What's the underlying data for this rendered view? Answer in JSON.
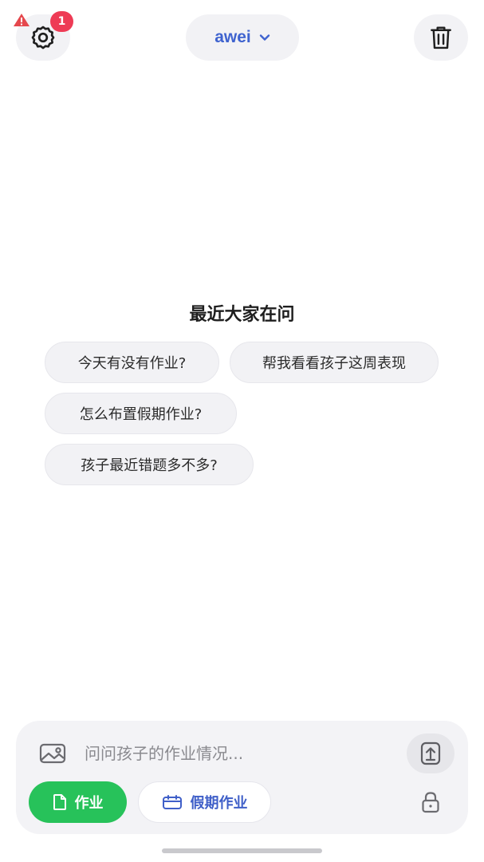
{
  "header": {
    "notification_count": "1",
    "user_name": "awei"
  },
  "main": {
    "section_title": "最近大家在问",
    "suggestions": [
      "今天有没有作业?",
      "帮我看看孩子这周表现",
      "怎么布置假期作业?",
      "孩子最近错题多不多?"
    ]
  },
  "composer": {
    "placeholder": "问问孩子的作业情况...",
    "value": "",
    "modes": {
      "homework": "作业",
      "holiday": "假期作业"
    }
  },
  "colors": {
    "accent_blue": "#3f63cf",
    "homework_green": "#27c25a",
    "badge_red": "#ee3b55",
    "warning_red": "#e5484d"
  },
  "icons": {
    "warning": "warning-triangle-icon",
    "settings": "gear-icon",
    "dropdown": "chevron-down-icon",
    "trash": "trash-icon",
    "image": "image-icon",
    "send": "upload-arrow-icon",
    "document": "document-icon",
    "calendar": "calendar-icon",
    "lock": "lock-icon"
  }
}
